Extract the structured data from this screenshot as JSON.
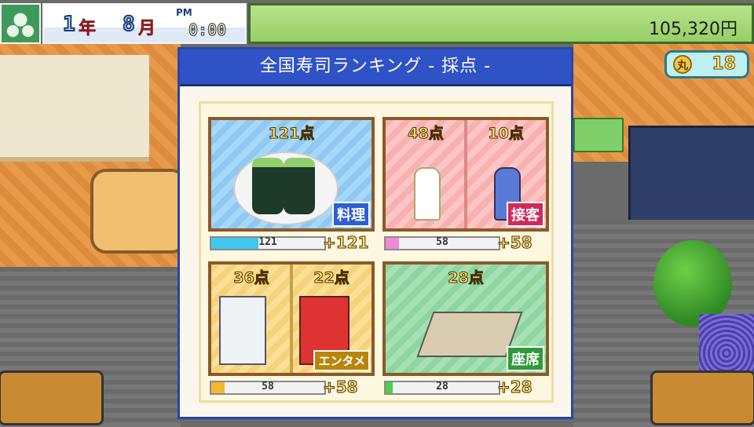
{
  "hud": {
    "year_num": "1",
    "year_unit": "年",
    "month_num": "8",
    "month_unit": "月",
    "ampm": "PM",
    "time": "0:00",
    "money": "105,320円",
    "coins": "18",
    "coin_glyph": "丸"
  },
  "dialog": {
    "title": "全国寿司ランキング - 採点 -"
  },
  "categories": [
    {
      "name": "料理",
      "scores": [
        "121点"
      ],
      "bar_value": "121",
      "bar_fraction": 0.42,
      "bar_color": "#3ec8f0",
      "plus": "+121",
      "badge_color": "#2f5fd0"
    },
    {
      "name": "接客",
      "scores": [
        "48点",
        "10点"
      ],
      "bar_value": "58",
      "bar_fraction": 0.12,
      "bar_color": "#f08ad6",
      "plus": "+58",
      "badge_color": "#d02a5a"
    },
    {
      "name": "エンタメ",
      "scores": [
        "36点",
        "22点"
      ],
      "bar_value": "58",
      "bar_fraction": 0.12,
      "bar_color": "#f5b632",
      "plus": "+58",
      "badge_color": "#b8860b"
    },
    {
      "name": "座席",
      "scores": [
        "28点"
      ],
      "bar_value": "28",
      "bar_fraction": 0.06,
      "bar_color": "#4ad04a",
      "plus": "+28",
      "badge_color": "#2f9a3a"
    }
  ]
}
